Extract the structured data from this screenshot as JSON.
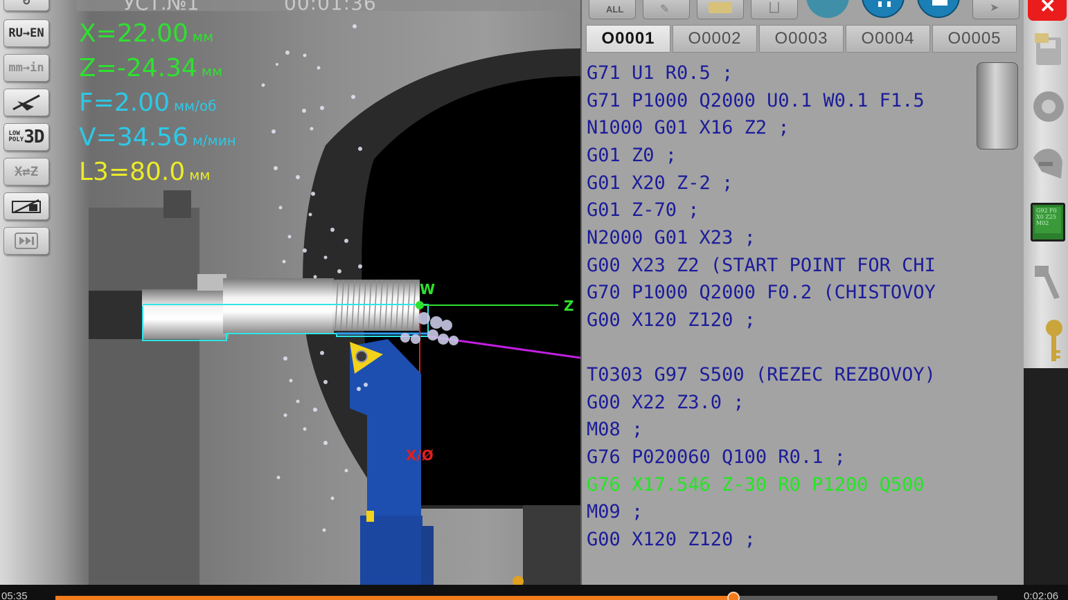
{
  "viewport": {
    "top_labels": {
      "setup": "УСТ.№1",
      "time": "00:01:36"
    },
    "toolbar": [
      {
        "id": "lang",
        "label": "RU→EN"
      },
      {
        "id": "units",
        "label": "mm→in"
      },
      {
        "id": "cut-view",
        "icon": "slash-tool-icon"
      },
      {
        "id": "lowpoly",
        "label_top": "LOW",
        "label_bottom": "POLY",
        "label_big": "3D"
      },
      {
        "id": "swap-axes",
        "label": "X⇄Z"
      },
      {
        "id": "section",
        "icon": "section-view-icon"
      },
      {
        "id": "fast-forward",
        "icon": "fast-forward-icon"
      }
    ],
    "readouts": {
      "x": {
        "label": "X=22.00",
        "unit": "мм"
      },
      "z": {
        "label": "Z=-24.34",
        "unit": "мм"
      },
      "f": {
        "label": "F=2.00",
        "unit": "мм/об"
      },
      "v": {
        "label": "V=34.56",
        "unit": "м/мин"
      },
      "l": {
        "label": "L3=80.0",
        "unit": "мм"
      }
    },
    "axes": {
      "w": "W",
      "z": "Z",
      "x": "X/Ø"
    },
    "colors": {
      "position": "#2fe030",
      "feed": "#2ec8e6",
      "length": "#ecec28",
      "x_axis": "#e02020",
      "tool_body": "#1d4fb0",
      "insert": "#f2d21a"
    }
  },
  "editor": {
    "top_buttons": {
      "all": "ALL"
    },
    "tabs": [
      "O0001",
      "O0002",
      "O0003",
      "O0004",
      "O0005"
    ],
    "active_tab": 0,
    "lines": [
      "G71 U1 R0.5 ;",
      "G71 P1000 Q2000 U0.1 W0.1 F1.5",
      "N1000 G01 X16 Z2 ;",
      "G01 Z0 ;",
      "G01 X20 Z-2 ;",
      "G01 Z-70 ;",
      "N2000 G01 X23 ;",
      "G00 X23 Z2 (START POINT FOR CHI",
      "G70 P1000 Q2000 F0.2 (CHISTOVOY",
      "G00 X120 Z120 ;",
      "",
      "T0303 G97 S500 (REZEC REZBOVOY)",
      "G00 X22 Z3.0 ;",
      "M08 ;",
      "G76 P020060 Q100 R0.1 ;",
      "G76 X17.546 Z-30 R0 P1200 Q500",
      "M09 ;",
      "G00 X120 Z120 ;"
    ],
    "current_line": 15,
    "colors": {
      "code": "#1c1c9a",
      "current": "#23e623",
      "panel": "#a3a3a3"
    }
  },
  "right_toolbar": {
    "close_label": "✕",
    "cycle_card_text": "G92 F0 X0 Z25 M02",
    "icons": [
      "save-icon",
      "chuck-icon",
      "tool-turret-icon",
      "caliper-icon",
      "key-icon"
    ]
  },
  "player": {
    "elapsed": "05:35",
    "remaining": "0:02:06",
    "progress": 0.72
  }
}
